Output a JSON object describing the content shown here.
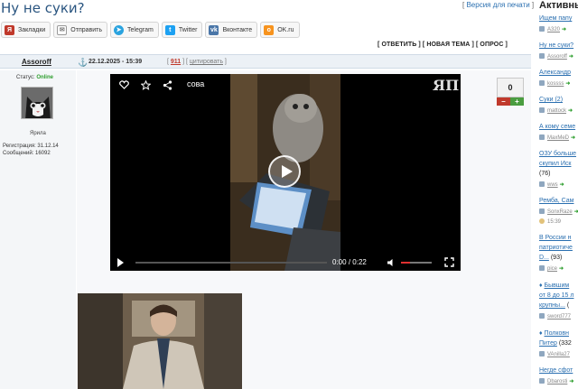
{
  "page": {
    "title": "Ну не суки?",
    "print_link": "Версия для печати"
  },
  "share": [
    {
      "label": "Закладки",
      "icon": "bookmark-icon",
      "color": "#c0392b"
    },
    {
      "label": "Отправить",
      "icon": "mail-icon",
      "color": "#7f8c8d"
    },
    {
      "label": "Telegram",
      "icon": "telegram-icon",
      "color": "#2aa3df"
    },
    {
      "label": "Twitter",
      "icon": "twitter-icon",
      "color": "#1da1f2"
    },
    {
      "label": "Вконтакте",
      "icon": "vk-icon",
      "color": "#4a76a8"
    },
    {
      "label": "OK.ru",
      "icon": "ok-icon",
      "color": "#f7931e"
    }
  ],
  "actions": {
    "reply": "ОТВЕТИТЬ",
    "new_topic": "НОВАЯ ТЕМА",
    "poll": "ОПРОС"
  },
  "post": {
    "author": "Assoroff",
    "date": "22.12.2025 - 15:39",
    "number": "911",
    "quote": "цитировать",
    "status_label": "Статус:",
    "status_value": "Online",
    "avatar_caption": "Ярила",
    "registered": "Регистрация: 31.12.14",
    "messages": "Сообщений: 16092",
    "rating": "0",
    "minus": "–",
    "plus": "+"
  },
  "video": {
    "title": "сова",
    "logo": "ЯП",
    "time_current": "0:00",
    "time_sep": "/",
    "time_total": "0:22",
    "volume_level": 0.3
  },
  "right": {
    "title": "Активные",
    "items": [
      {
        "title": "Ищем папу",
        "user": "A320"
      },
      {
        "title": "Ну не суки?",
        "user": "Assoroff"
      },
      {
        "title": "Александр",
        "user": "kossss"
      },
      {
        "title": "Суки (2)",
        "user": "mattock"
      },
      {
        "title": "А кому семе",
        "user": "MaxMeD"
      },
      {
        "title": "ОЗУ больше",
        "title2": "скупил Иск",
        "count": "(76)",
        "user": "wws"
      },
      {
        "title": "Ремба, Сам",
        "user": "SonxRaze",
        "time": "15:39"
      },
      {
        "title": "В России н",
        "title2": "патриотиче",
        "title3": "D...",
        "count": "(93)",
        "user": "pice"
      },
      {
        "title": "Бывшим",
        "title2": "от 8 до 15 л",
        "title3": "крупны...",
        "count": "(",
        "user": "sword777"
      },
      {
        "title": "Полковн",
        "title2": "Питер",
        "count": "(332",
        "user": "VAnilla27"
      },
      {
        "title": "Негде сфот",
        "user": "Dbarosti"
      }
    ]
  }
}
